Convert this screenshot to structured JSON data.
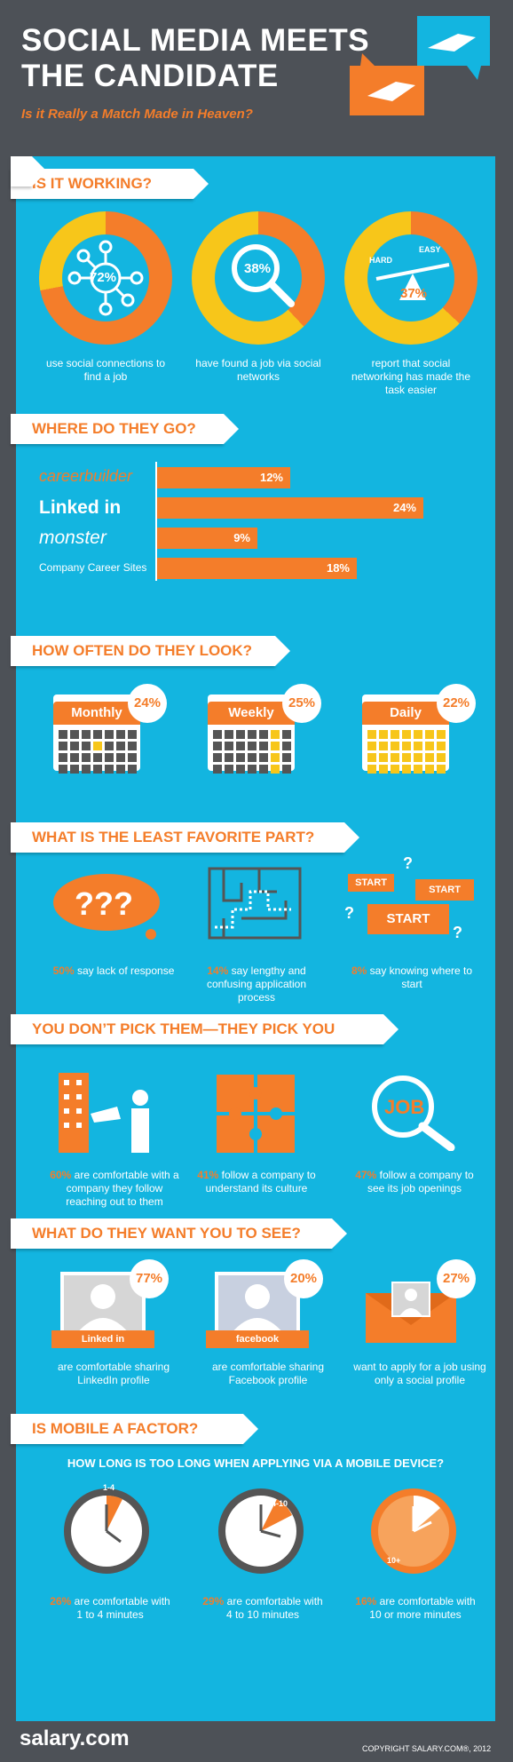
{
  "header": {
    "title_line1": "SOCIAL MEDIA MEETS",
    "title_line2": "THE CANDIDATE",
    "subtitle": "Is it Really a Match Made in Heaven?"
  },
  "section1": {
    "heading": "IS IT WORKING?",
    "stats": [
      {
        "percent": "72%",
        "caption": "use social connections to find a job",
        "value": 72
      },
      {
        "percent": "38%",
        "caption": "have found a job via social networks",
        "value": 38
      },
      {
        "percent": "37%",
        "caption": "report that social networking has made the task easier",
        "value": 37,
        "hard": "HARD",
        "easy": "EASY"
      }
    ]
  },
  "section2": {
    "heading": "WHERE DO THEY GO?",
    "bars": [
      {
        "label": "careerbuilder",
        "value": "12%",
        "num": 12
      },
      {
        "label": "Linked in",
        "value": "24%",
        "num": 24
      },
      {
        "label": "monster",
        "value": "9%",
        "num": 9
      },
      {
        "label": "Company Career Sites",
        "value": "18%",
        "num": 18
      }
    ]
  },
  "section3": {
    "heading": "HOW OFTEN DO THEY LOOK?",
    "items": [
      {
        "label": "Monthly",
        "percent": "24%"
      },
      {
        "label": "Weekly",
        "percent": "25%"
      },
      {
        "label": "Daily",
        "percent": "22%"
      }
    ]
  },
  "section4": {
    "heading": "WHAT IS THE LEAST FAVORITE PART?",
    "items": [
      {
        "pct": "50%",
        "text": "say lack of response"
      },
      {
        "pct": "14%",
        "text": "say lengthy and confusing application process"
      },
      {
        "pct": "8%",
        "text": "say knowing where to start"
      }
    ],
    "start_sign": "START"
  },
  "section5": {
    "heading": "YOU DON’T PICK THEM—THEY PICK YOU",
    "items": [
      {
        "pct": "60%",
        "text": "are comfortable with a company they follow reaching out to them"
      },
      {
        "pct": "41%",
        "text": "follow a company to understand its culture"
      },
      {
        "pct": "47%",
        "text": "follow a company to see its job openings"
      }
    ],
    "job_label": "JOB"
  },
  "section6": {
    "heading": "WHAT DO THEY WANT YOU TO SEE?",
    "items": [
      {
        "percent": "77%",
        "ribbon": "Linked in",
        "text": "are comfortable sharing LinkedIn profile"
      },
      {
        "percent": "20%",
        "ribbon": "facebook",
        "text": "are comfortable sharing Facebook profile"
      },
      {
        "percent": "27%",
        "ribbon": "",
        "text": "want to apply for a job using only a social profile"
      }
    ]
  },
  "section7": {
    "heading": "IS MOBILE A FACTOR?",
    "question": "HOW LONG IS TOO LONG WHEN APPLYING VIA A MOBILE DEVICE?",
    "items": [
      {
        "pct": "26%",
        "text": "are comfortable with 1 to 4 minutes",
        "clock_label": "1-4"
      },
      {
        "pct": "29%",
        "text": "are comfortable with 4 to 10 minutes",
        "clock_label": "4-10"
      },
      {
        "pct": "16%",
        "text": "are comfortable with 10 or more minutes",
        "clock_label": "10+"
      }
    ]
  },
  "footer": {
    "logo": "salary.com",
    "copyright": "COPYRIGHT SALARY.COM®, 2012"
  },
  "colors": {
    "orange": "#f47d2a",
    "yellow": "#f7c61a",
    "cyan": "#13b5e0",
    "slate": "#4d5157"
  }
}
